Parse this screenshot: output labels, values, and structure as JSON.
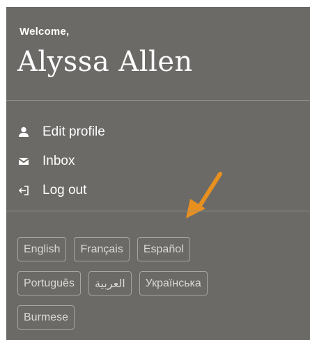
{
  "welcome_label": "Welcome,",
  "user_name": "Alyssa Allen",
  "menu": [
    {
      "label": "Edit profile",
      "icon": "user-icon"
    },
    {
      "label": "Inbox",
      "icon": "envelope-icon"
    },
    {
      "label": "Log out",
      "icon": "log-out-icon"
    }
  ],
  "languages": {
    "row1": [
      "English",
      "Français",
      "Español"
    ],
    "row2": [
      "Português",
      "العربية",
      "Українська"
    ],
    "row3": [
      "Burmese"
    ]
  },
  "colors": {
    "panel_background": "#6b6a67",
    "annotation_arrow": "#e8901f"
  },
  "annotation": {
    "icon": "arrow-annotation-icon"
  }
}
